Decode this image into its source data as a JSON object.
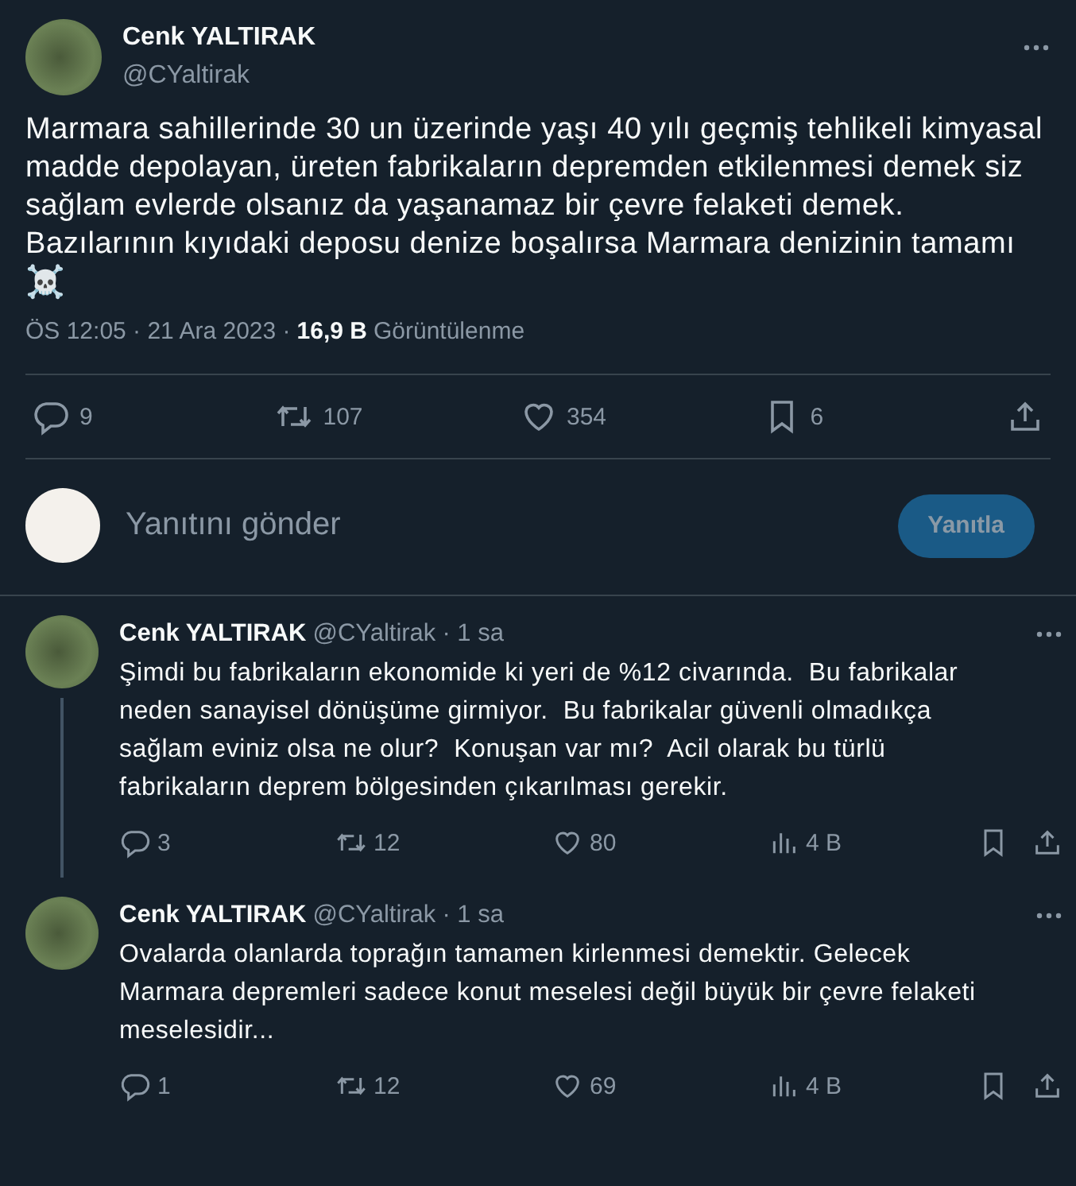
{
  "main_tweet": {
    "author": {
      "name": "Cenk YALTIRAK",
      "handle": "@CYaltirak"
    },
    "text": "Marmara sahillerinde 30 un üzerinde yaşı 40 yılı geçmiş tehlikeli kimyasal madde depolayan, üreten fabrikaların depremden etkilenmesi demek siz sağlam evlerde olsanız da yaşanamaz bir çevre felaketi demek. Bazılarının kıyıdaki deposu denize boşalırsa Marmara denizinin tamamı",
    "emoji": "☠️",
    "time": "ÖS 12:05 · 21 Ara 2023 ·",
    "views_count": "16,9 B",
    "views_label": "Görüntülenme",
    "actions": [
      {
        "kind": "reply",
        "count": "9"
      },
      {
        "kind": "retweet",
        "count": "107"
      },
      {
        "kind": "like",
        "count": "354"
      },
      {
        "kind": "bookmark",
        "count": "6"
      },
      {
        "kind": "share"
      }
    ]
  },
  "composer": {
    "placeholder": "Yanıtını gönder",
    "button": "Yanıtla",
    "disabled": true
  },
  "replies": [
    {
      "name": "Cenk YALTIRAK",
      "handle": "@CYaltirak",
      "time": "· 1 sa",
      "thread_line": true,
      "text": "Şimdi bu fabrikaların ekonomide ki yeri de %12 civarında.  Bu fabrikalar neden sanayisel dönüşüme girmiyor.  Bu fabrikalar güvenli olmadıkça sağlam eviniz olsa ne olur?  Konuşan var mı?  Acil olarak bu türlü fabrikaların deprem bölgesinden çıkarılması gerekir.",
      "actions": [
        {
          "kind": "reply",
          "count": "3"
        },
        {
          "kind": "retweet",
          "count": "12"
        },
        {
          "kind": "like",
          "count": "80"
        },
        {
          "kind": "views",
          "count": "4 B"
        },
        {
          "kind": "bookmark"
        },
        {
          "kind": "share"
        }
      ]
    },
    {
      "name": "Cenk YALTIRAK",
      "handle": "@CYaltirak",
      "time": "· 1 sa",
      "thread_line": false,
      "text": "Ovalarda olanlarda toprağın tamamen kirlenmesi demektir. Gelecek Marmara depremleri sadece konut meselesi değil büyük bir çevre felaketi meselesidir...",
      "actions": [
        {
          "kind": "reply",
          "count": "1"
        },
        {
          "kind": "retweet",
          "count": "12"
        },
        {
          "kind": "like",
          "count": "69"
        },
        {
          "kind": "views",
          "count": "4 B"
        },
        {
          "kind": "bookmark"
        },
        {
          "kind": "share"
        }
      ]
    }
  ]
}
